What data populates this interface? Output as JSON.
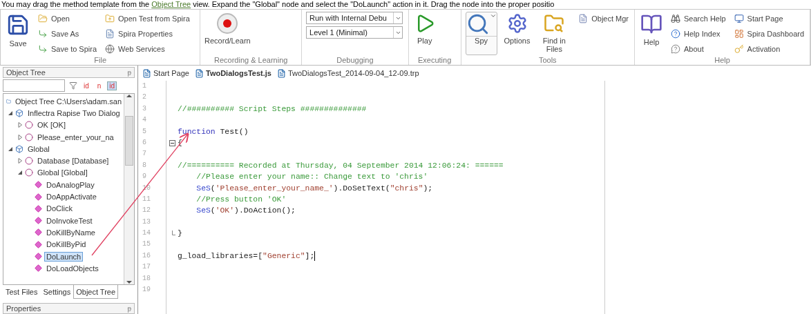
{
  "instruction": {
    "before": "You may drag the method template from the ",
    "link": "Object Tree",
    "after": " view. Expand the \"Global\" node and select the \"DoLaunch\" action in it. Drag the node into the proper positio"
  },
  "ribbon": {
    "groups": [
      {
        "label": "File",
        "items": [
          {
            "kind": "large",
            "label": "Save"
          },
          {
            "kind": "column",
            "entries": [
              {
                "kind": "button",
                "label": "Open"
              },
              {
                "kind": "button",
                "label": "Save As"
              },
              {
                "kind": "button",
                "label": "Save to Spira"
              }
            ]
          },
          {
            "kind": "column",
            "entries": [
              {
                "kind": "button",
                "label": "Open Test from Spira"
              },
              {
                "kind": "button",
                "label": "Spira Properties"
              },
              {
                "kind": "button",
                "label": "Web Services"
              }
            ]
          }
        ]
      },
      {
        "label": "Recording & Learning",
        "items": [
          {
            "kind": "large",
            "label": "Record/Learn"
          }
        ]
      },
      {
        "label": "Debugging",
        "items": [
          {
            "kind": "column",
            "entries": [
              {
                "kind": "dropdown",
                "value": "Run with Internal Debu"
              },
              {
                "kind": "dropdown",
                "value": "Level 1 (Minimal)"
              }
            ]
          }
        ]
      },
      {
        "label": "Executing",
        "items": [
          {
            "kind": "large",
            "label": "Play"
          }
        ]
      },
      {
        "label": "Tools",
        "items": [
          {
            "kind": "split",
            "label": "Spy"
          },
          {
            "kind": "large",
            "label": "Options"
          },
          {
            "kind": "large",
            "label": "Find in Files"
          },
          {
            "kind": "column",
            "entries": [
              {
                "kind": "button",
                "label": "Object Mgr"
              }
            ]
          }
        ]
      },
      {
        "label": "Help",
        "items": [
          {
            "kind": "large",
            "label": "Help"
          },
          {
            "kind": "column",
            "entries": [
              {
                "kind": "button",
                "label": "Search Help"
              },
              {
                "kind": "button",
                "label": "Help Index"
              },
              {
                "kind": "button",
                "label": "About"
              }
            ]
          },
          {
            "kind": "column",
            "entries": [
              {
                "kind": "button",
                "label": "Start Page"
              },
              {
                "kind": "button",
                "label": "Spira Dashboard"
              },
              {
                "kind": "button",
                "label": "Activation"
              }
            ]
          }
        ]
      }
    ]
  },
  "object_tree": {
    "title": "Object Tree",
    "pin": "ᵽ",
    "filters": [
      {
        "label": "id",
        "selected": false
      },
      {
        "label": "n",
        "selected": false
      },
      {
        "label": "id",
        "selected": true
      }
    ],
    "root": "Object Tree C:\\Users\\adam.san",
    "items": [
      {
        "label": "Inflectra Rapise Two Dialog",
        "expanded": true,
        "children": [
          {
            "label": "OK [OK]",
            "expanded": false,
            "selected": false
          },
          {
            "label": "Please_enter_your_na",
            "expanded": false,
            "selected": false
          }
        ],
        "selected": false
      },
      {
        "label": "Global",
        "expanded": true,
        "selected": false,
        "children": [
          {
            "label": "Database [Database]",
            "expanded": false,
            "selected": false
          },
          {
            "label": "Global [Global]",
            "expanded": true,
            "selected": false,
            "children": [
              {
                "label": "DoAnalogPlay",
                "selected": false
              },
              {
                "label": "DoAppActivate",
                "selected": false
              },
              {
                "label": "DoClick",
                "selected": false
              },
              {
                "label": "DoInvokeTest",
                "selected": false
              },
              {
                "label": "DoKillByName",
                "selected": false
              },
              {
                "label": "DoKillByPid",
                "selected": false
              },
              {
                "label": "DoLaunch",
                "selected": true
              },
              {
                "label": "DoLoadObjects",
                "selected": false
              }
            ]
          }
        ]
      }
    ],
    "tabs": [
      {
        "label": "Test Files",
        "selected": false
      },
      {
        "label": "Settings",
        "selected": false
      },
      {
        "label": "Object Tree",
        "selected": true
      }
    ]
  },
  "properties": {
    "title": "Properties",
    "pin": "ᵽ"
  },
  "editor": {
    "tabs": [
      {
        "label": "Start Page",
        "selected": false
      },
      {
        "label": "TwoDialogsTest.js",
        "selected": true
      },
      {
        "label": "TwoDialogsTest_2014-09-04_12-09.trp",
        "selected": false
      }
    ],
    "lines": [
      {
        "number": "1"
      },
      {
        "number": "2"
      },
      {
        "number": "3",
        "tokens": [
          {
            "kind": "comment",
            "text": "//########## Script Steps ##############"
          }
        ]
      },
      {
        "number": "4"
      },
      {
        "number": "5",
        "tokens": [
          {
            "kind": "keyword",
            "text": "function"
          },
          {
            "kind": "plain",
            "text": " Test()"
          }
        ]
      },
      {
        "number": "6",
        "collapsible": true,
        "tokens": [
          {
            "kind": "plain",
            "text": "{"
          }
        ]
      },
      {
        "number": "7"
      },
      {
        "number": "8",
        "tokens": [
          {
            "kind": "comment",
            "text": "//========== Recorded at Thursday, 04 September 2014 12:06:24: ======"
          }
        ]
      },
      {
        "number": "9",
        "tokens": [
          {
            "kind": "comment",
            "text": "    //Please enter your name:: Change text to 'chris'"
          }
        ]
      },
      {
        "number": "10",
        "tokens": [
          {
            "kind": "call",
            "text": "    SeS"
          },
          {
            "kind": "plain",
            "text": "("
          },
          {
            "kind": "string",
            "text": "'Please_enter_your_name_'"
          },
          {
            "kind": "plain",
            "text": ").DoSetText("
          },
          {
            "kind": "string",
            "text": "\"chris\""
          },
          {
            "kind": "plain",
            "text": ");"
          }
        ]
      },
      {
        "number": "11",
        "tokens": [
          {
            "kind": "comment",
            "text": "    //Press button 'OK'"
          }
        ]
      },
      {
        "number": "12",
        "tokens": [
          {
            "kind": "call",
            "text": "    SeS"
          },
          {
            "kind": "plain",
            "text": "("
          },
          {
            "kind": "string",
            "text": "'OK'"
          },
          {
            "kind": "plain",
            "text": ").DoAction();"
          }
        ]
      },
      {
        "number": "13"
      },
      {
        "number": "14",
        "block_end": true,
        "tokens": [
          {
            "kind": "plain",
            "text": "}"
          }
        ]
      },
      {
        "number": "15"
      },
      {
        "number": "16",
        "cursor": true,
        "tokens": [
          {
            "kind": "plain",
            "text": "g_load_libraries=["
          },
          {
            "kind": "string",
            "text": "\"Generic\""
          },
          {
            "kind": "plain",
            "text": "];"
          }
        ]
      },
      {
        "number": "17"
      },
      {
        "number": "18"
      },
      {
        "number": "19"
      }
    ]
  }
}
